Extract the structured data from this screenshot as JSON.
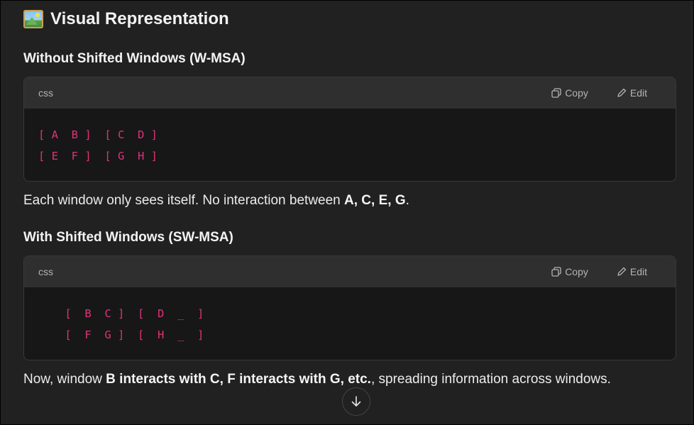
{
  "section": {
    "icon": "framed-picture-icon",
    "title": "Visual Representation"
  },
  "block1": {
    "heading": "Without Shifted Windows (W-MSA)",
    "lang": "css",
    "copy_label": "Copy",
    "edit_label": "Edit",
    "code": "[ A  B ]  [ C  D ]\n[ E  F ]  [ G  H ]",
    "after_text": {
      "prefix": "Each window only sees itself. No interaction between ",
      "bold": "A, C, E, G",
      "suffix": "."
    }
  },
  "block2": {
    "heading": "With Shifted Windows (SW-MSA)",
    "lang": "css",
    "copy_label": "Copy",
    "edit_label": "Edit",
    "code": "    [  B  C ]  [  D  _  ]\n    [  F  G ]  [  H  _  ]",
    "after_text": {
      "p1": "Now, window ",
      "b1": "B interacts with",
      "p2": " C, ",
      "b2": "F interacts with",
      "p3": " G, ",
      "b3": "etc.",
      "p4": ", spreading information across windows."
    }
  },
  "scroll_button": {
    "icon": "arrow-down-icon"
  },
  "colors": {
    "background": "#212121",
    "code_header": "#2f2f2f",
    "code_body": "#171717",
    "code_text": "#e0337a"
  }
}
